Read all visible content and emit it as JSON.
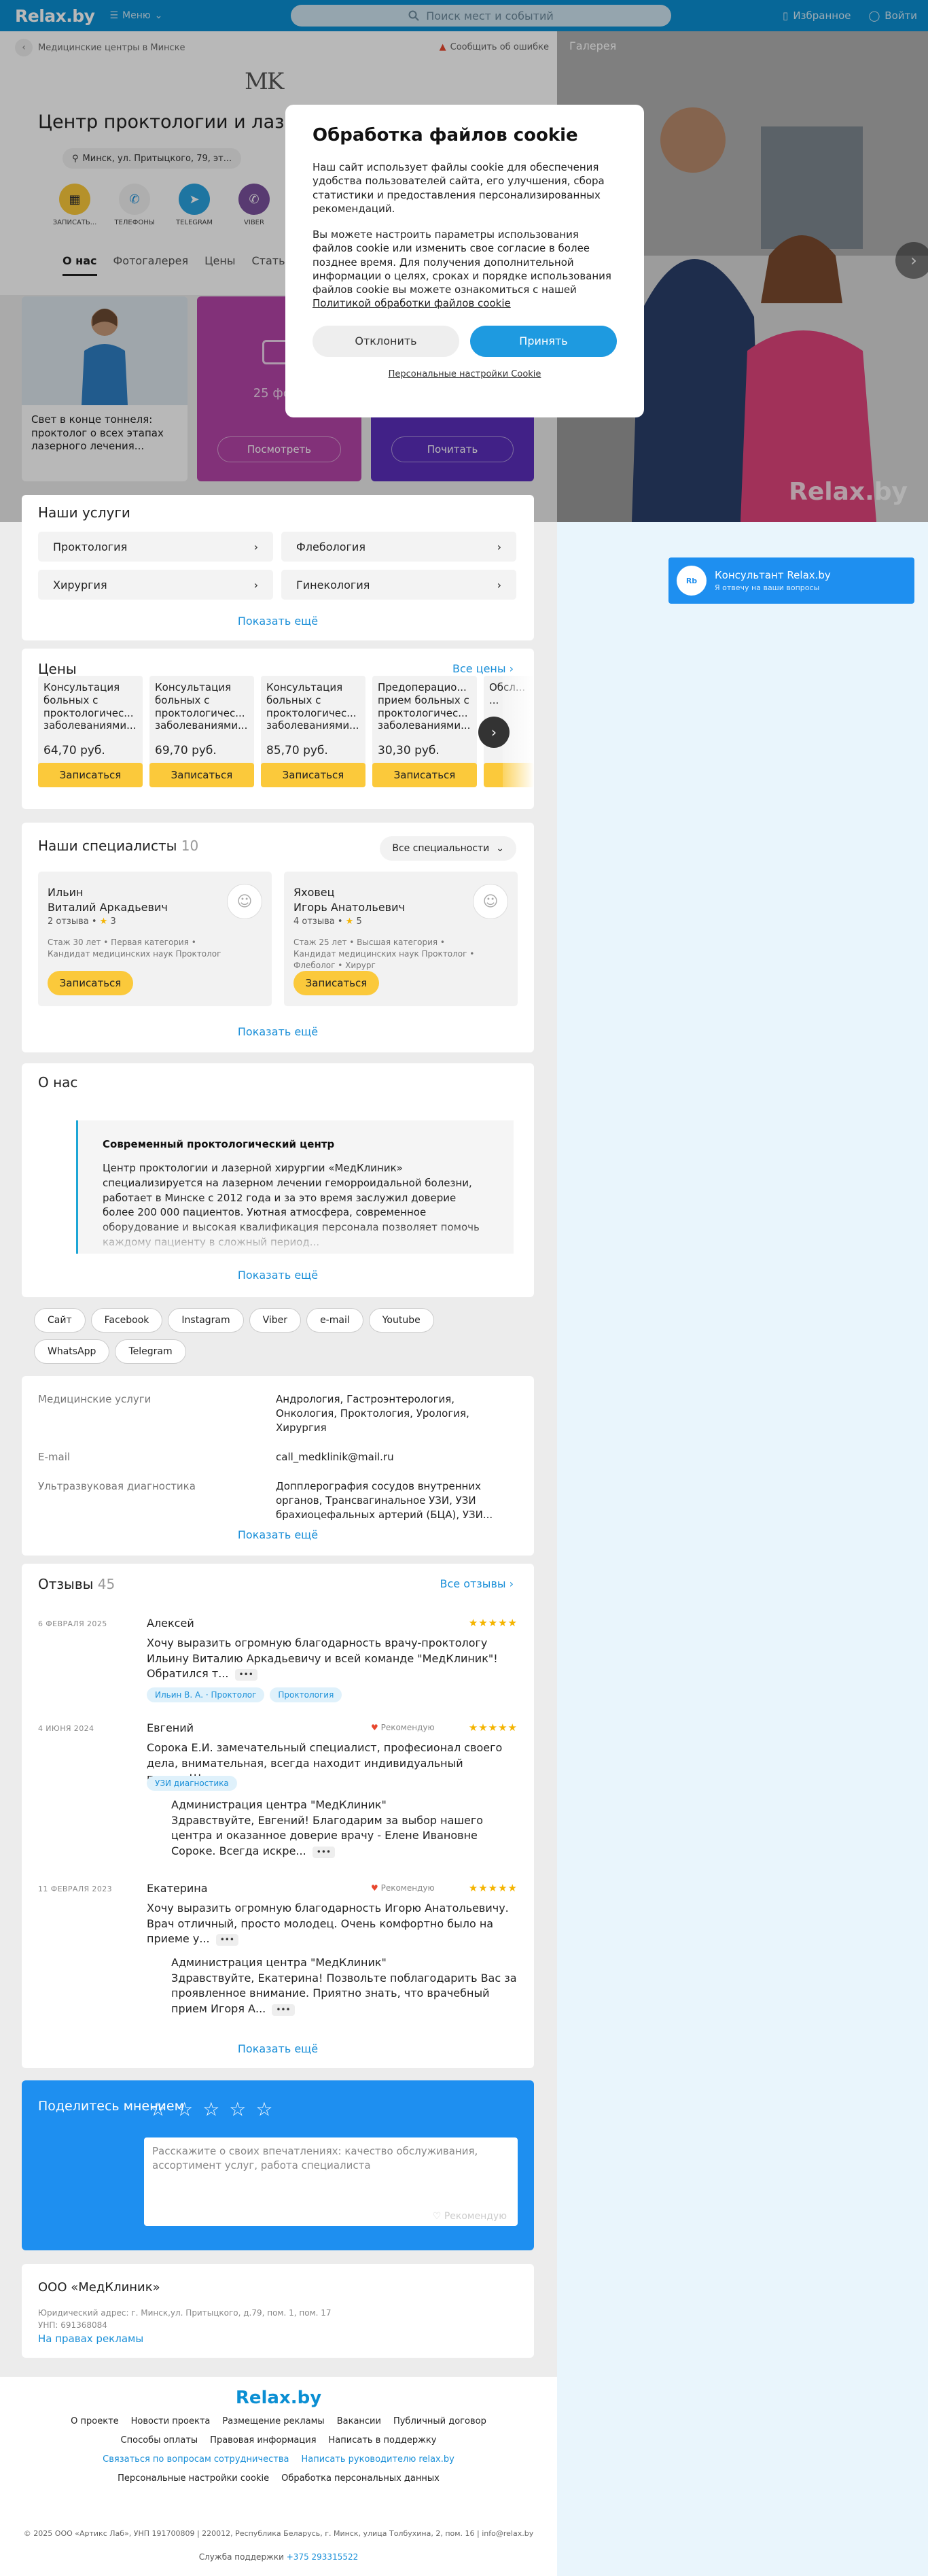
{
  "header": {
    "logo": "Relax.by",
    "menu": "Меню",
    "search_placeholder": "Поиск мест и событий",
    "favorites": "Избранное",
    "login": "Войти"
  },
  "breadcrumb": {
    "label": "Медицинские центры в Минске",
    "report": "Сообщить об ошибке"
  },
  "org": {
    "logo_text": "MK",
    "title": "Центр проктологии и лазерной хирургии «МедКлиник»",
    "address": "Минск, ул. Притыцкого, 79, эт...",
    "actions": [
      {
        "label": "ЗАПИСАТЬ...",
        "icon": "calendar-icon",
        "color": "#fbc93b"
      },
      {
        "label": "ТЕЛЕФОНЫ",
        "icon": "phone-icon",
        "color": "#f2f2f2"
      },
      {
        "label": "TELEGRAM",
        "icon": "telegram-icon",
        "color": "#2aa3df"
      },
      {
        "label": "VIBER",
        "icon": "viber-icon",
        "color": "#7b519d"
      }
    ],
    "tabs": [
      "О нас",
      "Фотогалерея",
      "Цены",
      "Статьи"
    ]
  },
  "gallery": {
    "label": "Галерея",
    "watermark": "Relax.by"
  },
  "promo": {
    "caption": "Свет в конце тоннеля: проктолог о всех этапах лазерного лечения...",
    "photos_text": "25 фото",
    "btn_view": "Посмотреть",
    "btn_read": "Почитать"
  },
  "cookie": {
    "title": "Обработка файлов cookie",
    "p1": "Наш сайт использует файлы cookie для обеспечения удобства пользователей сайта, его улучшения, сбора статистики и предоставления персонализированных рекомендаций.",
    "p2": "Вы можете настроить параметры использования файлов cookie или изменить свое согласие в более позднее время. Для получения дополнительной информации о целях, сроках и порядке использования файлов cookie вы можете ознакомиться с нашей",
    "p2_link": "Политикой обработки файлов cookie",
    "decline": "Отклонить",
    "accept": "Принять",
    "settings": "Персональные настройки Cookie"
  },
  "consultant": {
    "avatar": "Rb",
    "title": "Консультант Relax.by",
    "subtitle": "Я отвечу на ваши вопросы"
  },
  "services": {
    "title": "Наши услуги",
    "items": [
      "Проктология",
      "Флебология",
      "Хирургия",
      "Гинекология"
    ],
    "more": "Показать ещё"
  },
  "prices": {
    "title": "Цены",
    "all": "Все цены",
    "book": "Записаться",
    "items": [
      {
        "name": "Консультация больных с проктологичес... заболеваниями...",
        "price": "64,70 руб."
      },
      {
        "name": "Консультация больных с проктологичес... заболеваниями...",
        "price": "69,70 руб."
      },
      {
        "name": "Консультация больных с проктологичес... заболеваниями...",
        "price": "85,70 руб."
      },
      {
        "name": "Предоперацио... прием больных с проктологичес... заболеваниями...",
        "price": "30,30 руб."
      },
      {
        "name": "Обсл... ...",
        "price": ""
      }
    ]
  },
  "specialists": {
    "title": "Наши специалисты",
    "count": "10",
    "filter": "Все специальности",
    "book": "Записаться",
    "more": "Показать ещё",
    "items": [
      {
        "surname": "Ильин",
        "name": "Виталий Аркадьевич",
        "reviews": "2 отзыва",
        "rating": "3",
        "details": "Стаж 30 лет • Первая категория • Кандидат медицинских наук Проктолог"
      },
      {
        "surname": "Яховец",
        "name": "Игорь Анатольевич",
        "reviews": "4 отзыва",
        "rating": "5",
        "details": "Стаж 25 лет • Высшая категория • Кандидат медицинских наук Проктолог • Флеболог • Хирург"
      }
    ]
  },
  "about": {
    "title": "О нас",
    "quote_title": "Современный проктологический центр",
    "quote_body": "Центр проктологии и лазерной хирургии «МедКлиник» специализируется на лазерном лечении геморроидальной болезни, работает в Минске с 2012 года и за это время заслужил доверие более 200 000 пациентов. Уютная атмосфера, современное оборудование и высокая квалификация персонала позволяет помочь каждому пациенту в сложный период...",
    "more": "Показать ещё"
  },
  "links": [
    "Сайт",
    "Facebook",
    "Instagram",
    "Viber",
    "e-mail",
    "Youtube",
    "WhatsApp",
    "Telegram"
  ],
  "properties": {
    "rows": [
      {
        "key": "Медицинские услуги",
        "value": "Андрология, Гастроэнтерология, Онкология, Проктология, Урология, Хирургия"
      },
      {
        "key": "E-mail",
        "value": "call_medklinik@mail.ru"
      },
      {
        "key": "Ультразвуковая диагностика",
        "value": "Допплерография сосудов внутренних органов, Трансвагинальное УЗИ, УЗИ брахиоцефальных артерий (БЦА), УЗИ..."
      }
    ],
    "more": "Показать ещё"
  },
  "reviews": {
    "title": "Отзывы",
    "count": "45",
    "all": "Все отзывы",
    "more": "Показать ещё",
    "recommend": "Рекомендую",
    "stars": "★★★★★",
    "items": [
      {
        "date": "6 ФЕВРАЛЯ 2025",
        "author": "Алексей",
        "text": "Хочу выразить огромную благодарность врачу-проктологу Ильину Виталию Аркадьевичу и всей команде \"МедКлиник\"! Обратился т...",
        "tags": [
          "Ильин В. А. · Проктолог",
          "Проктология"
        ]
      },
      {
        "date": "4 ИЮНЯ 2024",
        "author": "Евгений",
        "text": "Сорока Е.И. замечательный специалист, професионал своего дела, внимательная, всегда находит индивидуальный подход!!!",
        "tags": [
          "УЗИ диагностика"
        ],
        "reply_title": "Администрация центра \"МедКлиник\"",
        "reply": "Здравствуйте, Евгений! Благодарим за выбор нашего центра и оказанное доверие врачу - Елене Ивановне Сороке. Всегда искре..."
      },
      {
        "date": "11 ФЕВРАЛЯ 2023",
        "author": "Екатерина",
        "text": "Хочу выразить огромную благодарность Игорю Анатольевичу. Врач отличный, просто молодец. Очень комфортно было на приеме у...",
        "reply_title": "Администрация центра \"МедКлиник\"",
        "reply": "Здравствуйте, Екатерина! Позвольте поблагодарить Вас за проявленное внимание. Приятно знать, что врачебный прием Игоря А..."
      }
    ]
  },
  "share": {
    "title": "Поделитесь мнением",
    "placeholder": "Расскажите о своих впечатлениях: качество обслуживания, ассортимент услуг, работа специалиста",
    "recommend": "Рекомендую"
  },
  "company": {
    "name": "ООО «МедКлиник»",
    "address": "Юридический адрес: г. Минск,ул. Притыцкого, д.79, пом. 1, пом. 17",
    "unp": "УНП: 691368084",
    "ad": "На правах рекламы"
  },
  "footer": {
    "logo": "Relax.by",
    "row1": [
      "О проекте",
      "Новости проекта",
      "Размещение рекламы",
      "Вакансии",
      "Публичный договор"
    ],
    "row2": [
      "Способы оплаты",
      "Правовая информация",
      "Написать в поддержку"
    ],
    "row3": [
      "Связаться по вопросам сотрудничества",
      "Написать руководителю relax.by"
    ],
    "row4": [
      "Персональные настройки cookie",
      "Обработка персональных данных"
    ],
    "copyright": "© 2025 ООО «Артикс Лаб», УНП 191700809 | 220012, Республика Беларусь, г. Минск, улица Толбухина, 2, пом. 16 | info@relax.by",
    "support_label": "Служба поддержки",
    "support_phone": "+375 293315522"
  }
}
